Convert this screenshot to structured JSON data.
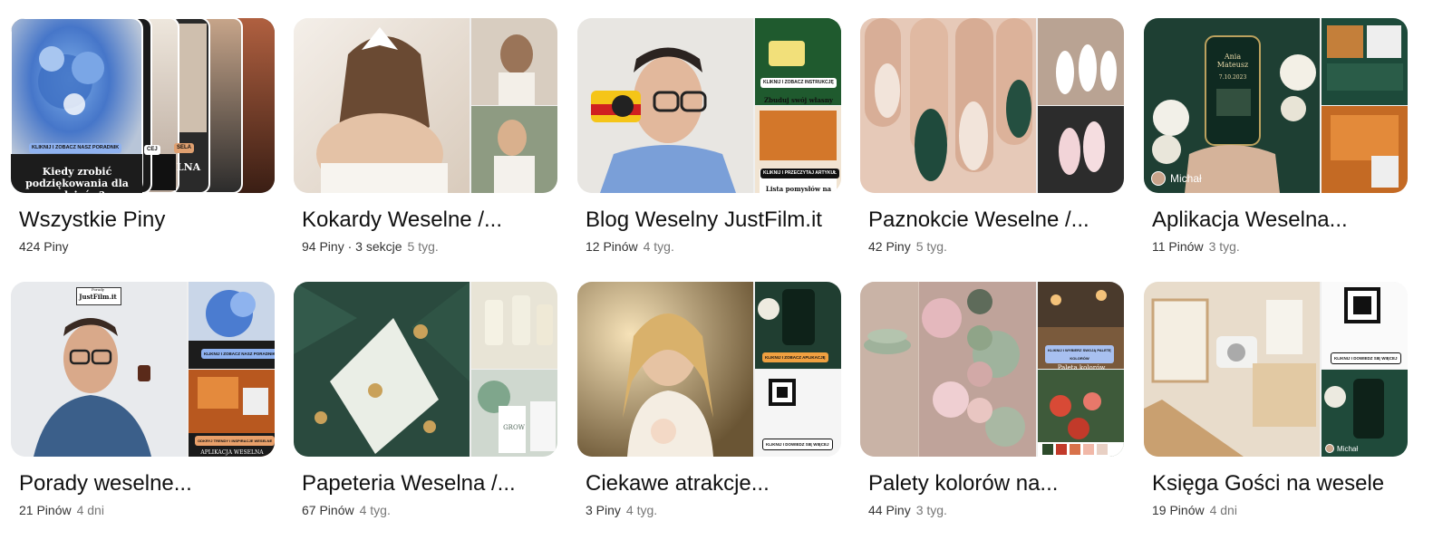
{
  "boards": [
    {
      "title": "Wszystkie Piny",
      "count": "424 Piny",
      "sections": "",
      "age": "",
      "cover_texts": {
        "pill": "KLIKNIJ I ZOBACZ NASZ PORADNIK",
        "caption": "Kiedy zrobić podziękowania dla rodziców?",
        "stack_pill1": "CEJ",
        "stack_pill2": "SELA",
        "stack_text": "LNA"
      }
    },
    {
      "title": "Kokardy Weselne /...",
      "count": "94 Piny",
      "sections": " · 3 sekcje",
      "age": "5 tyg."
    },
    {
      "title": "Blog Weselny JustFilm.it",
      "count": "12 Pinów",
      "sections": "",
      "age": "4 tyg.",
      "cover_texts": {
        "side_pill1": "KLIKNIJ I ZOBACZ INSTRUKCJĘ",
        "side_text1": "Zbuduj swój własny",
        "side_pill2": "KLIKNIJ I PRZECZYTAJ ARTYKUŁ",
        "side_text2": "Lista pomysłów na"
      }
    },
    {
      "title": "Paznokcie Weselne /...",
      "count": "42 Piny",
      "sections": "",
      "age": "5 tyg."
    },
    {
      "title": "Aplikacja Weselna...",
      "count": "11 Pinów",
      "sections": "",
      "age": "3 tyg.",
      "cover_texts": {
        "avatar_name": "Michał",
        "phone_names": "Ania Mateusz",
        "phone_date": "7.10.2023"
      }
    },
    {
      "title": "Porady weselne...",
      "count": "21 Pinów",
      "sections": "",
      "age": "4 dni",
      "cover_texts": {
        "sign": "JustFilm.it",
        "sign_small": "Porady",
        "pill1": "KLIKNIJ I ZOBACZ NASZ PORADNIK",
        "pill2": "ODKRYJ TRENDY I INSPIRACJE WESELNE",
        "bottom": "APLIKACJA WESELNA"
      }
    },
    {
      "title": "Papeteria Weselna /...",
      "count": "67 Pinów",
      "sections": "",
      "age": "4 tyg.",
      "cover_texts": {
        "tag": "GROW"
      }
    },
    {
      "title": "Ciekawe atrakcje...",
      "count": "3 Piny",
      "sections": "",
      "age": "4 tyg.",
      "cover_texts": {
        "pill1": "KLIKNIJ I ZOBACZ APLIKACJĘ",
        "pill2": "KLIKNIJ I DOWIEDZ SIĘ WIĘCEJ"
      }
    },
    {
      "title": "Palety kolorów na...",
      "count": "44 Piny",
      "sections": "",
      "age": "3 tyg.",
      "cover_texts": {
        "pill": "KLIKNIJ I WYBIERZ SWOJĄ PALETĘ KOLORÓW",
        "label": "Paleta kolorów"
      }
    },
    {
      "title": "Księga Gości na wesele",
      "count": "19 Pinów",
      "sections": "",
      "age": "4 dni",
      "cover_texts": {
        "pill": "KLIKNIJ I DOWIEDZ SIĘ WIĘCEJ",
        "avatar_name": "Michał"
      }
    }
  ],
  "colors": {
    "pin_red": "#e60023",
    "text": "#111111",
    "muted": "#767676",
    "placeholder": "#efefef"
  }
}
